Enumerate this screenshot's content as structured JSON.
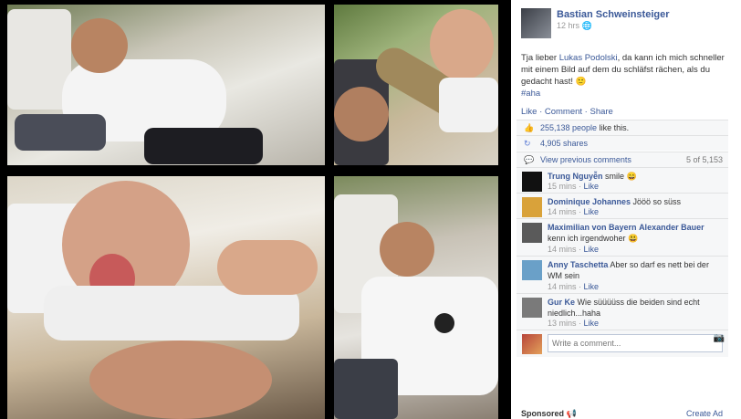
{
  "post": {
    "author": "Bastian Schweinsteiger",
    "time": "12 hrs",
    "text_before": "Tja lieber ",
    "mention": "Lukas Podolski",
    "text_after": ", da kann ich mich schneller mit einem Bild auf dem du schläfst rächen, als du gedacht hast! 🙂",
    "hashtag": "#aha",
    "actions": "Like · Comment · Share",
    "likes_count": "255,138 people",
    "likes_suffix": "like this.",
    "shares": "4,905 shares",
    "view_previous": "View previous comments",
    "comment_count": "5 of 5,153"
  },
  "comments": [
    {
      "name": "Trung Nguyễn",
      "text": "smile 😄",
      "time": "15 mins",
      "like": "Like",
      "color": "#111111"
    },
    {
      "name": "Dominique Johannes",
      "text": "Jööö so süss",
      "time": "14 mins",
      "like": "Like",
      "color": "#d9a23a"
    },
    {
      "name": "Maximilian von Bayern",
      "mention": "Alexander Bauer",
      "text": "kenn ich irgendwoher 😃",
      "time": "14 mins",
      "like": "Like",
      "color": "#5a5a5a"
    },
    {
      "name": "Anny Taschetta",
      "text": "Aber so darf es nett bei der WM sein",
      "time": "14 mins",
      "like": "Like",
      "color": "#6aa0c8"
    },
    {
      "name": "Gur Ke",
      "text": "Wie süüüüss die beiden sind echt niedlich...haha",
      "time": "13 mins",
      "like": "Like",
      "color": "#7a7a7a"
    }
  ],
  "write_comment": {
    "placeholder": "Write a comment..."
  },
  "footer": {
    "sponsored": "Sponsored",
    "create_ad": "Create Ad"
  },
  "photos": [
    {
      "description": "Man sleeping on lounge chair in white shirt"
    },
    {
      "description": "Selfie smiling with sleeping man behind"
    },
    {
      "description": "Selfie sticking tongue out over sleeping man"
    },
    {
      "description": "Man sleeping on wicker lounge chair"
    }
  ]
}
